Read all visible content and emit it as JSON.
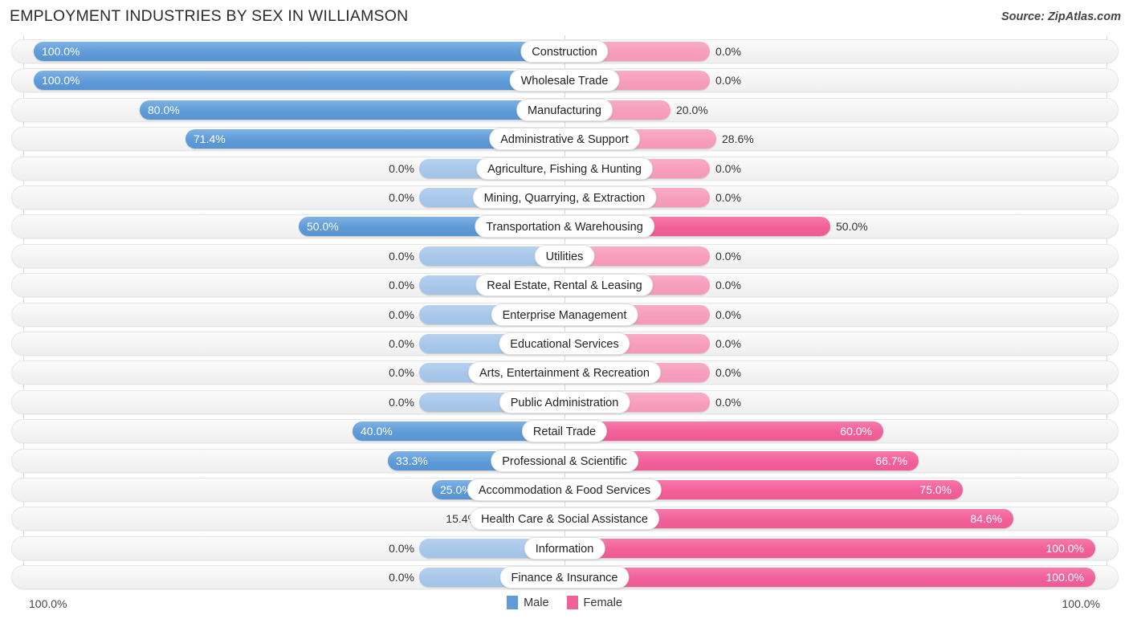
{
  "header": {
    "title": "EMPLOYMENT INDUSTRIES BY SEX IN WILLIAMSON",
    "source": "Source: ZipAtlas.com"
  },
  "legend": {
    "male_label": "Male",
    "female_label": "Female",
    "male_color": "#5e9bd8",
    "female_color": "#f2609a"
  },
  "axis": {
    "left_label": "100.0%",
    "right_label": "100.0%",
    "max": 100.0
  },
  "chart_data": {
    "type": "bar",
    "subtype": "diverging-bidirectional",
    "title": "EMPLOYMENT INDUSTRIES BY SEX IN WILLIAMSON",
    "xlabel": "",
    "ylabel": "",
    "xlim": [
      100.0,
      100.0
    ],
    "grid": false,
    "legend_position": "bottom-center",
    "categories": [
      "Construction",
      "Wholesale Trade",
      "Manufacturing",
      "Administrative & Support",
      "Agriculture, Fishing & Hunting",
      "Mining, Quarrying, & Extraction",
      "Transportation & Warehousing",
      "Utilities",
      "Real Estate, Rental & Leasing",
      "Enterprise Management",
      "Educational Services",
      "Arts, Entertainment & Recreation",
      "Public Administration",
      "Retail Trade",
      "Professional & Scientific",
      "Accommodation & Food Services",
      "Health Care & Social Assistance",
      "Information",
      "Finance & Insurance"
    ],
    "series": [
      {
        "name": "Male",
        "color": "#5e9bd8",
        "values": [
          100.0,
          100.0,
          80.0,
          71.4,
          0.0,
          0.0,
          50.0,
          0.0,
          0.0,
          0.0,
          0.0,
          0.0,
          0.0,
          40.0,
          33.3,
          25.0,
          15.4,
          0.0,
          0.0
        ],
        "labels": [
          "100.0%",
          "100.0%",
          "80.0%",
          "71.4%",
          "0.0%",
          "0.0%",
          "50.0%",
          "0.0%",
          "0.0%",
          "0.0%",
          "0.0%",
          "0.0%",
          "0.0%",
          "40.0%",
          "33.3%",
          "25.0%",
          "15.4%",
          "0.0%",
          "0.0%"
        ]
      },
      {
        "name": "Female",
        "color": "#f2609a",
        "values": [
          0.0,
          0.0,
          20.0,
          28.6,
          0.0,
          0.0,
          50.0,
          0.0,
          0.0,
          0.0,
          0.0,
          0.0,
          0.0,
          60.0,
          66.7,
          75.0,
          84.6,
          100.0,
          100.0
        ],
        "labels": [
          "0.0%",
          "0.0%",
          "20.0%",
          "28.6%",
          "0.0%",
          "0.0%",
          "50.0%",
          "0.0%",
          "0.0%",
          "0.0%",
          "0.0%",
          "0.0%",
          "0.0%",
          "60.0%",
          "66.7%",
          "75.0%",
          "84.6%",
          "100.0%",
          "100.0%"
        ]
      }
    ]
  }
}
